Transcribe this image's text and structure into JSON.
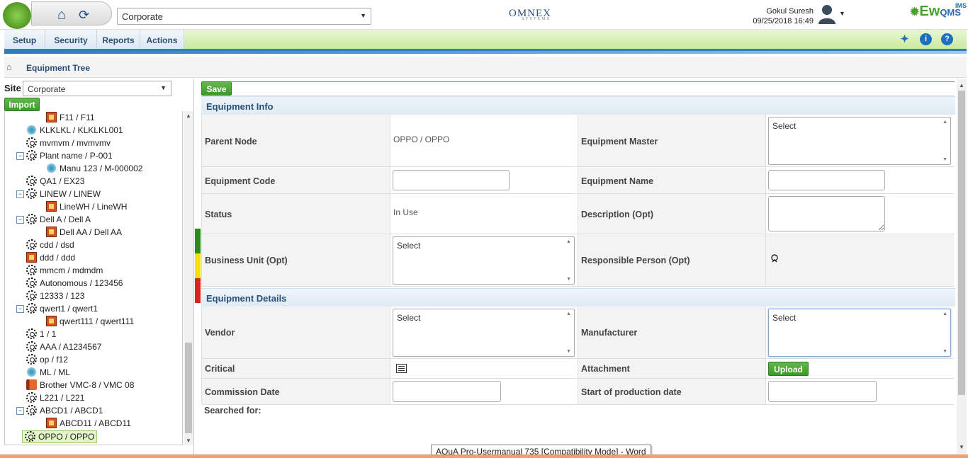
{
  "header": {
    "site_value": "Corporate",
    "brand": "OMNEX",
    "brand_sub": "SYSTEMS",
    "user_name": "Gokul Suresh",
    "datetime": "09/25/2018 16:49",
    "product_main": "Ew",
    "product_ims": "IMS",
    "product_qms": "QMS"
  },
  "menu": {
    "items": [
      "Setup",
      "Security",
      "Reports",
      "Actions"
    ]
  },
  "breadcrumb": {
    "title": "Equipment Tree"
  },
  "left": {
    "site_label": "Site",
    "site_value": "Corporate",
    "import_label": "Import",
    "tree": [
      {
        "label": "F11 / F11",
        "icon": "box-icon",
        "level": 2,
        "toggle": ""
      },
      {
        "label": "KLKLKL / KLKLKL001",
        "icon": "cog-icon",
        "level": 1,
        "toggle": ""
      },
      {
        "label": "mvmvm / mvmvmv",
        "icon": "gear-icon",
        "level": 1,
        "toggle": ""
      },
      {
        "label": "Plant name / P-001",
        "icon": "gear-icon",
        "level": 1,
        "toggle": "⊖"
      },
      {
        "label": "Manu 123 / M-000002",
        "icon": "cog-icon",
        "level": 2,
        "toggle": ""
      },
      {
        "label": "QA1 / EX23",
        "icon": "gear-icon",
        "level": 1,
        "toggle": ""
      },
      {
        "label": "LINEW / LINEW",
        "icon": "gear-icon",
        "level": 1,
        "toggle": "⊖"
      },
      {
        "label": "LineWH / LineWH",
        "icon": "box-icon",
        "level": 2,
        "toggle": ""
      },
      {
        "label": "Dell A / Dell A",
        "icon": "gear-icon",
        "level": 1,
        "toggle": "⊖"
      },
      {
        "label": "Dell AA / Dell AA",
        "icon": "box-icon",
        "level": 2,
        "toggle": ""
      },
      {
        "label": "cdd / dsd",
        "icon": "gear-icon",
        "level": 1,
        "toggle": ""
      },
      {
        "label": "ddd / ddd",
        "icon": "box-icon",
        "level": 1,
        "toggle": ""
      },
      {
        "label": "mmcm / mdmdm",
        "icon": "gear-icon",
        "level": 1,
        "toggle": ""
      },
      {
        "label": "Autonomous / 123456",
        "icon": "gear-icon",
        "level": 1,
        "toggle": ""
      },
      {
        "label": "12333 / 123",
        "icon": "gear-icon",
        "level": 1,
        "toggle": ""
      },
      {
        "label": "qwert1 / qwert1",
        "icon": "gear-icon",
        "level": 1,
        "toggle": "⊖"
      },
      {
        "label": "qwert111 / qwert111",
        "icon": "box-icon",
        "level": 2,
        "toggle": ""
      },
      {
        "label": "1 / 1",
        "icon": "gear-icon",
        "level": 1,
        "toggle": ""
      },
      {
        "label": "AAA / A1234567",
        "icon": "gear-icon",
        "level": 1,
        "toggle": ""
      },
      {
        "label": "op / f12",
        "icon": "gear-icon",
        "level": 1,
        "toggle": ""
      },
      {
        "label": "ML / ML",
        "icon": "cog-icon",
        "level": 1,
        "toggle": ""
      },
      {
        "label": "Brother VMC-8 / VMC 08",
        "icon": "book-icon",
        "level": 1,
        "toggle": ""
      },
      {
        "label": "L221 / L221",
        "icon": "gear-icon",
        "level": 1,
        "toggle": ""
      },
      {
        "label": "ABCD1 / ABCD1",
        "icon": "gear-icon",
        "level": 1,
        "toggle": "⊖"
      },
      {
        "label": "ABCD11 / ABCD11",
        "icon": "box-icon",
        "level": 2,
        "toggle": ""
      },
      {
        "label": "OPPO / OPPO",
        "icon": "gear-icon",
        "level": 1,
        "toggle": "",
        "selected": true
      }
    ]
  },
  "form": {
    "save_label": "Save",
    "equipment_info_title": "Equipment Info",
    "parent_node_label": "Parent Node",
    "parent_node_value": "OPPO / OPPO",
    "equipment_master_label": "Equipment Master",
    "equipment_master_value": "Select",
    "equipment_code_label": "Equipment Code",
    "equipment_code_value": "",
    "equipment_name_label": "Equipment Name",
    "equipment_name_value": "",
    "status_label": "Status",
    "status_value": "In Use",
    "description_label": "Description (Opt)",
    "description_value": "",
    "business_unit_label": "Business Unit (Opt)",
    "business_unit_value": "Select",
    "responsible_person_label": "Responsible Person (Opt)",
    "equipment_details_title": "Equipment Details",
    "vendor_label": "Vendor",
    "vendor_value": "Select",
    "manufacturer_label": "Manufacturer",
    "manufacturer_value": "Select",
    "critical_label": "Critical",
    "attachment_label": "Attachment",
    "upload_label": "Upload",
    "commission_date_label": "Commission Date",
    "commission_date_value": "",
    "start_production_label": "Start of production date",
    "start_production_value": "",
    "searched_for_label": "Searched for:"
  },
  "taskbar_tooltip": "AQuA Pro-Usermanual 735 [Compatibility Mode] - Word",
  "colors": {
    "accent_green": "#4aa02c",
    "menu_text": "#2b4f7a",
    "traffic_green": "#2a8a1e",
    "traffic_yellow": "#f2e200",
    "traffic_red": "#d9261c"
  }
}
